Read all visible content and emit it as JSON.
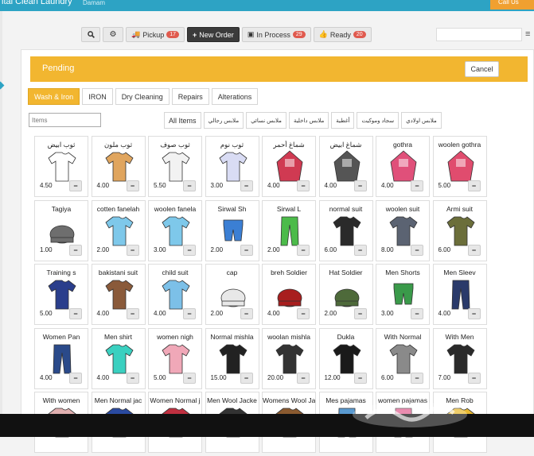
{
  "header": {
    "app_title": "ital Clean Laundry",
    "city": "Damam",
    "call_label": "Call Us"
  },
  "toolbar": {
    "search_label": "",
    "settings_label": "",
    "pickup_label": "Pickup",
    "pickup_count": "17",
    "new_order_label": "New Order",
    "in_process_label": "In Process",
    "in_process_count": "29",
    "ready_label": "Ready",
    "ready_count": "20"
  },
  "pending": {
    "title": "Pending",
    "cancel_label": "Cancel"
  },
  "service_tabs": [
    {
      "label": "Wash & Iron"
    },
    {
      "label": "IRON"
    },
    {
      "label": "Dry Cleaning"
    },
    {
      "label": "Repairs"
    },
    {
      "label": "Alterations"
    }
  ],
  "search": {
    "placeholder": "Items"
  },
  "categories": [
    {
      "label": "All Items"
    },
    {
      "label": "ملابس رجالي"
    },
    {
      "label": "ملابس نسائي"
    },
    {
      "label": "ملابس داخلية"
    },
    {
      "label": "أغطية"
    },
    {
      "label": "سجاد وموكيت"
    },
    {
      "label": "ملابس اولادي"
    }
  ],
  "items": [
    {
      "name": "ثوب ابيض",
      "price": "4.50",
      "icon": "white-thobe-icon",
      "color": "#ffffff"
    },
    {
      "name": "ثوب ملون",
      "price": "4.00",
      "icon": "colored-thobe-icon",
      "color": "#e0a55e"
    },
    {
      "name": "ثوب صوف",
      "price": "5.50",
      "icon": "wool-thobe-icon",
      "color": "#f2f2f2"
    },
    {
      "name": "ثوب نوم",
      "price": "3.00",
      "icon": "sleep-thobe-icon",
      "color": "#d9dcf4"
    },
    {
      "name": "شماغ أحمر",
      "price": "4.00",
      "icon": "red-shemagh-icon",
      "color": "#d03a52"
    },
    {
      "name": "شماغ ابيض",
      "price": "4.00",
      "icon": "white-shemagh-icon",
      "color": "#555555"
    },
    {
      "name": "gothra",
      "price": "4.00",
      "icon": "gothra-icon",
      "color": "#e0507a"
    },
    {
      "name": "woolen gothra",
      "price": "5.00",
      "icon": "woolen-gothra-icon",
      "color": "#e04c6e"
    },
    {
      "name": "Tagiya",
      "price": "1.00",
      "icon": "tagiya-icon",
      "color": "#6e6e6e"
    },
    {
      "name": "cotten fanelah",
      "price": "2.00",
      "icon": "cotton-tshirt-icon",
      "color": "#7ec8ea"
    },
    {
      "name": "woolen  fanela",
      "price": "3.00",
      "icon": "woolen-tshirt-icon",
      "color": "#7ec8ea"
    },
    {
      "name": "Sirwal Sh",
      "price": "2.00",
      "icon": "sirwal-short-icon",
      "color": "#3b7fd4"
    },
    {
      "name": "Sirwal L",
      "price": "2.00",
      "icon": "sirwal-long-icon",
      "color": "#4cbb4a"
    },
    {
      "name": "normal suit",
      "price": "6.00",
      "icon": "normal-suit-icon",
      "color": "#2a2a2a"
    },
    {
      "name": "woolen suit",
      "price": "8.00",
      "icon": "woolen-suit-icon",
      "color": "#5b6372"
    },
    {
      "name": "Armi suit",
      "price": "6.00",
      "icon": "army-suit-icon",
      "color": "#6b6e3a"
    },
    {
      "name": "Training s",
      "price": "5.00",
      "icon": "training-suit-icon",
      "color": "#2a3e8c"
    },
    {
      "name": "bakistani suit",
      "price": "4.00",
      "icon": "pakistani-suit-icon",
      "color": "#8a5a3a"
    },
    {
      "name": "child  suit",
      "price": "4.00",
      "icon": "child-suit-icon",
      "color": "#7cc0e8"
    },
    {
      "name": "cap",
      "price": "2.00",
      "icon": "cap-icon",
      "color": "#e8e8e8"
    },
    {
      "name": "breh Soldier",
      "price": "4.00",
      "icon": "beret-icon",
      "color": "#a81e1e"
    },
    {
      "name": "Hat Soldier",
      "price": "2.00",
      "icon": "helmet-icon",
      "color": "#4e6a3a"
    },
    {
      "name": "Men Shorts",
      "price": "3.00",
      "icon": "shorts-icon",
      "color": "#3a9a4a"
    },
    {
      "name": "Men Sleev",
      "price": "4.00",
      "icon": "trousers-icon",
      "color": "#2a3a6a"
    },
    {
      "name": "Women Pan",
      "price": "4.00",
      "icon": "women-pants-icon",
      "color": "#2a4a8a"
    },
    {
      "name": "Men shirt",
      "price": "4.00",
      "icon": "men-shirt-icon",
      "color": "#3ad0c0"
    },
    {
      "name": "women nigh",
      "price": "5.00",
      "icon": "nightgown-icon",
      "color": "#f0a8b8"
    },
    {
      "name": "Normal  mishla",
      "price": "15.00",
      "icon": "mishlah-icon",
      "color": "#222222"
    },
    {
      "name": "woolan  mishla",
      "price": "20.00",
      "icon": "woolen-mishlah-icon",
      "color": "#333333"
    },
    {
      "name": "Dukla",
      "price": "12.00",
      "icon": "dukla-icon",
      "color": "#1a1a1a"
    },
    {
      "name": "With Normal",
      "price": "6.00",
      "icon": "vest-icon",
      "color": "#8a8a8a"
    },
    {
      "name": "With Men",
      "price": "7.00",
      "icon": "men-jacket-icon",
      "color": "#2a2a2a"
    },
    {
      "name": "With women",
      "price": "",
      "icon": "women-item-icon",
      "color": "#e0b0b0"
    },
    {
      "name": "Men Normal jac",
      "price": "",
      "icon": "men-normal-jacket-icon",
      "color": "#2a4aa0"
    },
    {
      "name": "Women Normal j",
      "price": "",
      "icon": "women-jacket-icon",
      "color": "#c03040"
    },
    {
      "name": "Men Wool Jacke",
      "price": "",
      "icon": "men-wool-jacket-icon",
      "color": "#333333"
    },
    {
      "name": "Womens Wool Ja",
      "price": "",
      "icon": "women-wool-jacket-icon",
      "color": "#8a5a30"
    },
    {
      "name": "Mes pajamas",
      "price": "",
      "icon": "men-pajamas-icon",
      "color": "#5a9ad0"
    },
    {
      "name": "women pajamas",
      "price": "",
      "icon": "women-pajamas-icon",
      "color": "#e06090"
    },
    {
      "name": "Men Rob",
      "price": "",
      "icon": "men-robe-icon",
      "color": "#e8b830"
    }
  ],
  "minus_label": "−"
}
